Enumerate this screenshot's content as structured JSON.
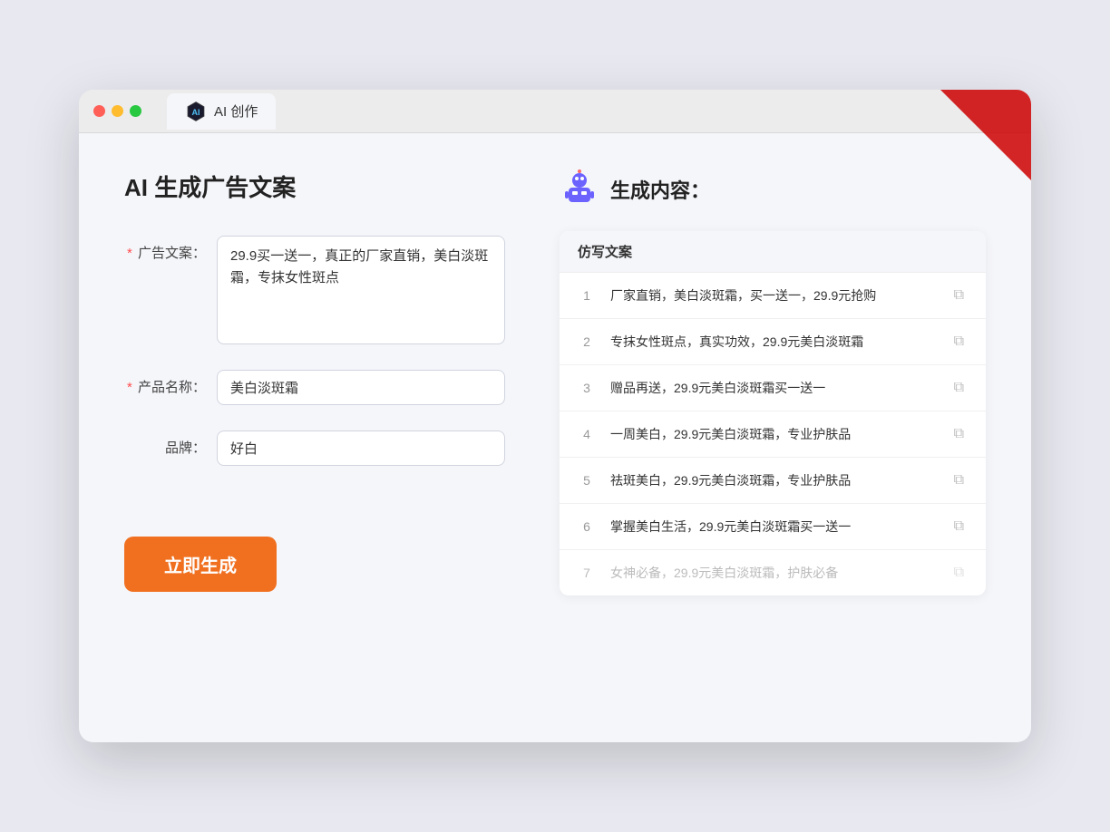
{
  "window": {
    "tab_label": "AI 创作"
  },
  "left_panel": {
    "title": "AI 生成广告文案",
    "fields": [
      {
        "id": "ad_copy",
        "label": "广告文案：",
        "required": true,
        "type": "textarea",
        "value": "29.9买一送一，真正的厂家直销，美白淡斑霜，专抹女性斑点"
      },
      {
        "id": "product_name",
        "label": "产品名称：",
        "required": true,
        "type": "input",
        "value": "美白淡斑霜"
      },
      {
        "id": "brand",
        "label": "品牌：",
        "required": false,
        "type": "input",
        "value": "好白"
      }
    ],
    "generate_button": "立即生成"
  },
  "right_panel": {
    "title": "生成内容：",
    "table_header": "仿写文案",
    "results": [
      {
        "number": "1",
        "text": "厂家直销，美白淡斑霜，买一送一，29.9元抢购",
        "faded": false
      },
      {
        "number": "2",
        "text": "专抹女性斑点，真实功效，29.9元美白淡斑霜",
        "faded": false
      },
      {
        "number": "3",
        "text": "赠品再送，29.9元美白淡斑霜买一送一",
        "faded": false
      },
      {
        "number": "4",
        "text": "一周美白，29.9元美白淡斑霜，专业护肤品",
        "faded": false
      },
      {
        "number": "5",
        "text": "祛斑美白，29.9元美白淡斑霜，专业护肤品",
        "faded": false
      },
      {
        "number": "6",
        "text": "掌握美白生活，29.9元美白淡斑霜买一送一",
        "faded": false
      },
      {
        "number": "7",
        "text": "女神必备，29.9元美白淡斑霜，护肤必备",
        "faded": true
      }
    ]
  },
  "colors": {
    "accent_orange": "#f07020",
    "required_red": "#ff4d4f",
    "ai_purple": "#5b6af0"
  }
}
